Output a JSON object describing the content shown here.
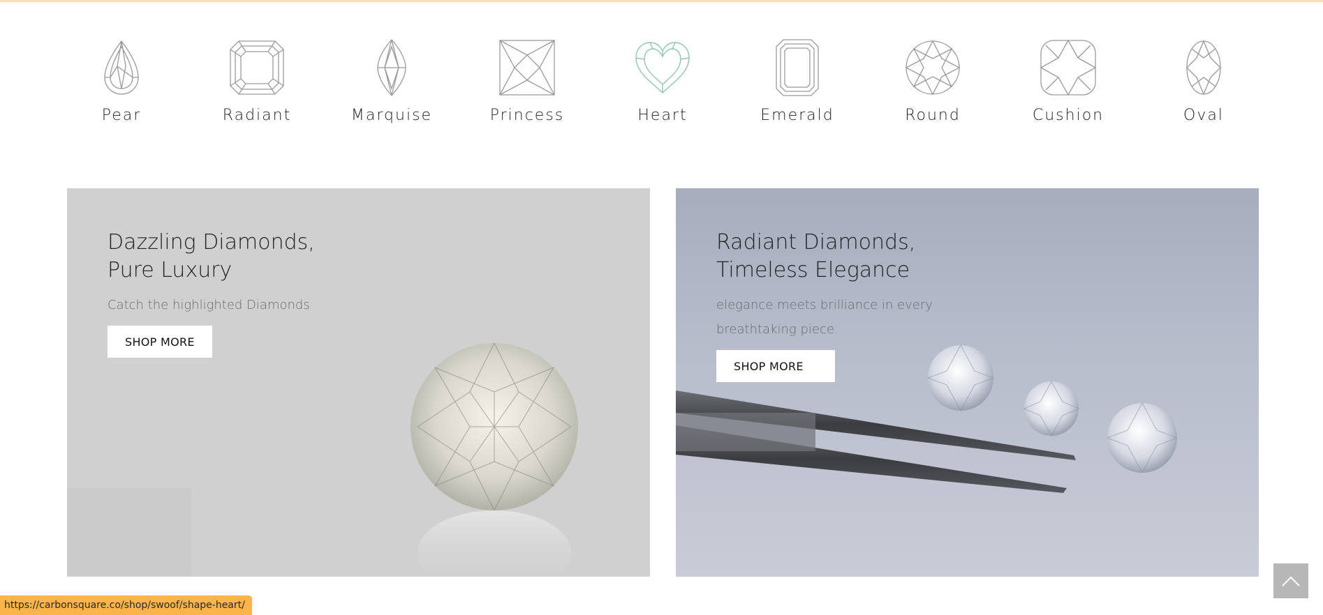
{
  "shapes": [
    {
      "label": "Pear",
      "icon": "pear-shape-icon"
    },
    {
      "label": "Radiant",
      "icon": "radiant-shape-icon"
    },
    {
      "label": "Marquise",
      "icon": "marquise-shape-icon"
    },
    {
      "label": "Princess",
      "icon": "princess-shape-icon"
    },
    {
      "label": "Heart",
      "icon": "heart-shape-icon",
      "color": "#8fc8ad"
    },
    {
      "label": "Emerald",
      "icon": "emerald-shape-icon"
    },
    {
      "label": "Round",
      "icon": "round-shape-icon"
    },
    {
      "label": "Cushion",
      "icon": "cushion-shape-icon"
    },
    {
      "label": "Oval",
      "icon": "oval-shape-icon"
    }
  ],
  "banners": {
    "left": {
      "title": "Dazzling Diamonds,\nPure Luxury",
      "subtitle": "Catch the highlighted Diamonds",
      "button": "SHOP MORE"
    },
    "right": {
      "title": "Radiant Diamonds,\nTimeless Elegance",
      "subtitle": "elegance meets brilliance in every breathtaking piece.",
      "button": "SHOP MORE"
    }
  },
  "status_bar": {
    "url": "https://carbonsquare.co/shop/swoof/shape-heart/"
  },
  "colors": {
    "icon_stroke": "#9a9a9a",
    "heart_accent": "#8fc8ad",
    "status_bg": "#fbb44a"
  }
}
